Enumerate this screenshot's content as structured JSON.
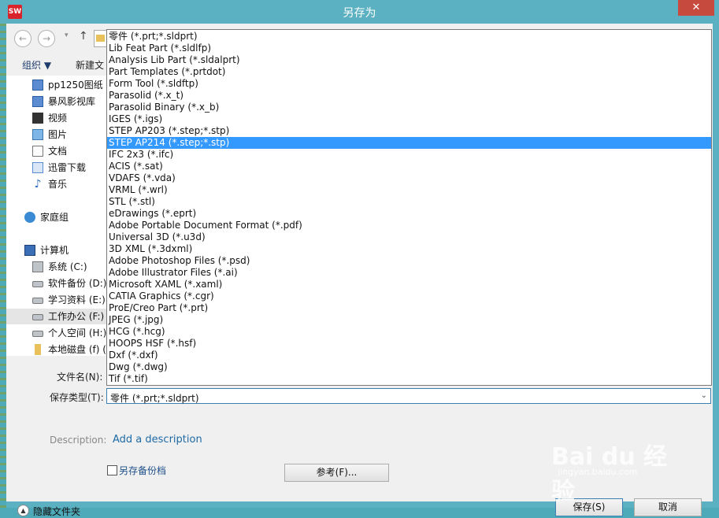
{
  "window": {
    "title": "另存为",
    "app_icon_label": "SW",
    "close_glyph": "✕"
  },
  "nav": {
    "back_glyph": "←",
    "forward_glyph": "→",
    "dropdown_glyph": "▾",
    "up_glyph": "↑"
  },
  "toolbar": {
    "organize": "组织 ▼",
    "new_folder": "新建文"
  },
  "tree": [
    {
      "label": "pp1250图纸",
      "icon": "library-icon"
    },
    {
      "label": "暴风影视库",
      "icon": "library-icon"
    },
    {
      "label": "视频",
      "icon": "film-icon"
    },
    {
      "label": "图片",
      "icon": "picture-icon"
    },
    {
      "label": "文档",
      "icon": "document-icon"
    },
    {
      "label": "迅雷下载",
      "icon": "download-icon"
    },
    {
      "label": "音乐",
      "icon": "music-icon"
    },
    {
      "label": "家庭组",
      "icon": "homegroup-icon"
    },
    {
      "label": "计算机",
      "icon": "computer-icon"
    },
    {
      "label": "系统 (C:)",
      "icon": "system-drive-icon"
    },
    {
      "label": "软件备份 (D:)",
      "icon": "drive-icon"
    },
    {
      "label": "学习资料 (E:)",
      "icon": "drive-icon"
    },
    {
      "label": "工作办公 (F:)",
      "icon": "drive-icon"
    },
    {
      "label": "个人空间 (H:)",
      "icon": "drive-icon"
    },
    {
      "label": "本地磁盘 (f) (",
      "icon": "usb-drive-icon"
    }
  ],
  "form": {
    "filename_label": "文件名(N):",
    "filetype_label": "保存类型(T):",
    "filetype_value": "零件 (*.prt;*.sldprt)",
    "filetype_arrow": "⌄",
    "description_label": "Description:",
    "description_link": "Add a description",
    "backup_checkbox_label": "另存备份档",
    "references_button": "参考(F)...",
    "hide_folders_label": "隐藏文件夹",
    "hide_folders_glyph": "▲",
    "save_button": "保存(S)",
    "cancel_button": "取消"
  },
  "filetype_options": [
    "零件 (*.prt;*.sldprt)",
    "Lib Feat Part (*.sldlfp)",
    "Analysis Lib Part (*.sldalprt)",
    "Part Templates (*.prtdot)",
    "Form Tool (*.sldftp)",
    "Parasolid (*.x_t)",
    "Parasolid Binary (*.x_b)",
    "IGES (*.igs)",
    "STEP AP203 (*.step;*.stp)",
    "STEP AP214 (*.step;*.stp)",
    "IFC 2x3 (*.ifc)",
    "ACIS (*.sat)",
    "VDAFS (*.vda)",
    "VRML (*.wrl)",
    "STL (*.stl)",
    "eDrawings (*.eprt)",
    "Adobe Portable Document Format (*.pdf)",
    "Universal 3D (*.u3d)",
    "3D XML (*.3dxml)",
    "Adobe Photoshop Files (*.psd)",
    "Adobe Illustrator Files (*.ai)",
    "Microsoft XAML (*.xaml)",
    "CATIA Graphics (*.cgr)",
    "ProE/Creo Part (*.prt)",
    "JPEG (*.jpg)",
    "HCG (*.hcg)",
    "HOOPS HSF (*.hsf)",
    "Dxf (*.dxf)",
    "Dwg (*.dwg)",
    "Tif (*.tif)"
  ],
  "highlighted_option": "STEP AP214 (*.step;*.stp)",
  "watermark": {
    "text": "Bai du 经验",
    "url": "jingyan.baidu.com"
  },
  "colors": {
    "titlebar": "#5bb1c1",
    "selection": "#3399ff",
    "close": "#c74a3e"
  }
}
